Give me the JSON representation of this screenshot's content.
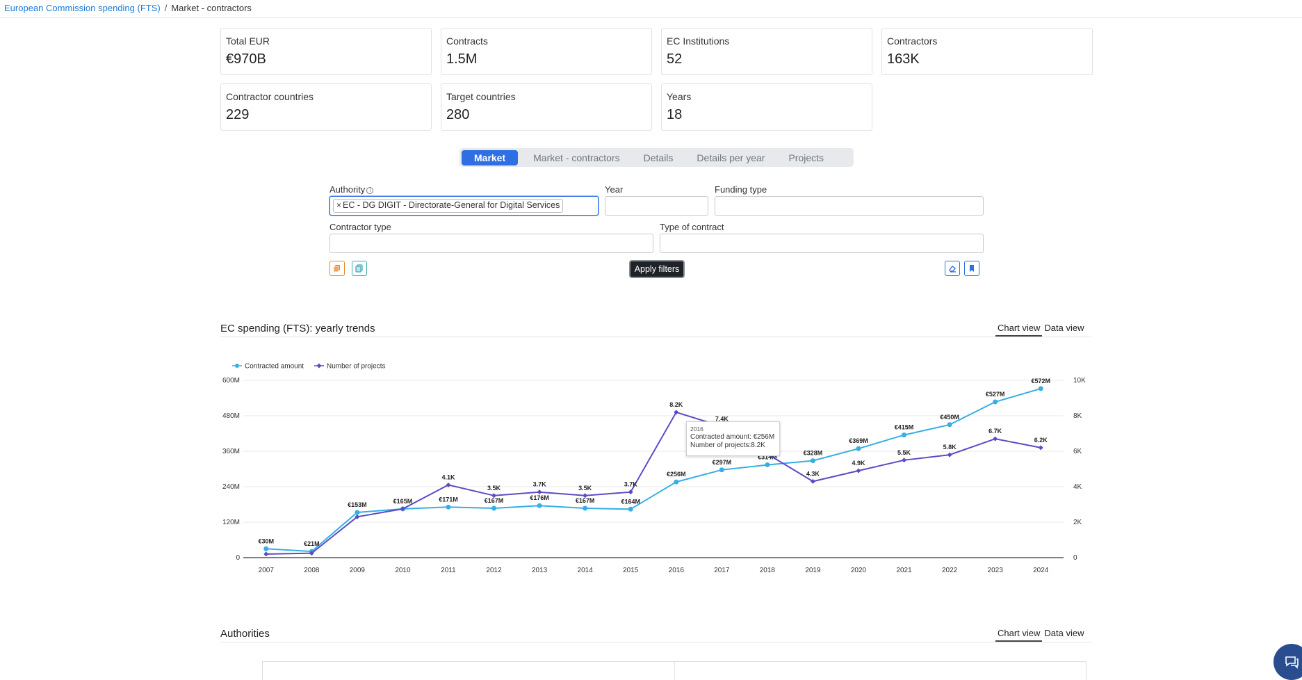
{
  "breadcrumb": {
    "link": "European Commission spending (FTS)",
    "separator": "/",
    "current": "Market - contractors"
  },
  "stats": [
    {
      "label": "Total EUR",
      "value": "€970B"
    },
    {
      "label": "Contracts",
      "value": "1.5M"
    },
    {
      "label": "EC Institutions",
      "value": "52"
    },
    {
      "label": "Contractors",
      "value": "163K"
    },
    {
      "label": "Contractor countries",
      "value": "229"
    },
    {
      "label": "Target countries",
      "value": "280"
    },
    {
      "label": "Years",
      "value": "18"
    }
  ],
  "tabs": [
    {
      "label": "Market",
      "active": true
    },
    {
      "label": "Market - contractors",
      "active": false
    },
    {
      "label": "Details",
      "active": false
    },
    {
      "label": "Details per year",
      "active": false
    },
    {
      "label": "Projects",
      "active": false
    }
  ],
  "filters": {
    "authority": {
      "label": "Authority",
      "chip": "EC - DG DIGIT - Directorate-General for Digital Services",
      "chip_remove": "×",
      "info_icon": "info-icon"
    },
    "year": {
      "label": "Year",
      "value": ""
    },
    "funding_type": {
      "label": "Funding type",
      "value": ""
    },
    "contractor_type": {
      "label": "Contractor type",
      "value": ""
    },
    "type_of_contract": {
      "label": "Type of contract",
      "value": ""
    },
    "apply_label": "Apply filters",
    "left_icons": [
      "copy-icon",
      "duplicate-icon"
    ],
    "right_icons": [
      "eraser-icon",
      "bookmark-icon"
    ],
    "colors": {
      "copy": "#e8862a",
      "duplicate": "#3aa7b5",
      "right": "#2f6fe4"
    }
  },
  "trend_section": {
    "title": "EC spending (FTS): yearly trends",
    "views": [
      "Chart view",
      "Data view"
    ]
  },
  "chart_data": {
    "type": "line",
    "x": [
      "2007",
      "2008",
      "2009",
      "2010",
      "2011",
      "2012",
      "2013",
      "2014",
      "2015",
      "2016",
      "2017",
      "2018",
      "2019",
      "2020",
      "2021",
      "2022",
      "2023",
      "2024"
    ],
    "series": [
      {
        "name": "Contracted amount",
        "axis": "left",
        "color": "#36aee6",
        "values": [
          30,
          21,
          153,
          165,
          171,
          167,
          176,
          167,
          164,
          256,
          297,
          314,
          328,
          369,
          415,
          450,
          527,
          572
        ],
        "labels": [
          "€30M",
          "€21M",
          "€153M",
          "€165M",
          "€171M",
          "€167M",
          "€176M",
          "€167M",
          "€164M",
          "€256M",
          "€297M",
          "€314M",
          "€328M",
          "€369M",
          "€415M",
          "€450M",
          "€527M",
          "€572M"
        ]
      },
      {
        "name": "Number of projects",
        "axis": "right",
        "color": "#5b4bc4",
        "values": [
          0.2,
          0.25,
          2.3,
          2.75,
          4.1,
          3.5,
          3.7,
          3.5,
          3.7,
          8.2,
          7.4,
          null,
          4.3,
          4.9,
          5.5,
          5.8,
          6.7,
          6.2
        ],
        "labels": [
          "",
          "",
          "",
          "",
          "4.1K",
          "3.5K",
          "3.7K",
          "3.5K",
          "3.7K",
          "8.2K",
          "7.4K",
          "",
          "4.3K",
          "4.9K",
          "5.5K",
          "5.8K",
          "6.7K",
          "6.2K"
        ]
      }
    ],
    "y_left": {
      "range": [
        0,
        600
      ],
      "ticks": [
        "0",
        "120M",
        "240M",
        "360M",
        "480M",
        "600M"
      ]
    },
    "y_right": {
      "range": [
        0,
        10
      ],
      "ticks": [
        "0",
        "2K",
        "4K",
        "6K",
        "8K",
        "10K"
      ]
    },
    "legend_position": "top-left",
    "grid": true,
    "tooltip": {
      "year": "2016",
      "line1": "Contracted amount: €256M",
      "line2": "Number of projects:8.2K"
    }
  },
  "authorities_section": {
    "title": "Authorities",
    "views": [
      "Chart view",
      "Data view"
    ]
  },
  "chat_button": {
    "icon": "chat-icon",
    "color": "#2a4d8f"
  }
}
